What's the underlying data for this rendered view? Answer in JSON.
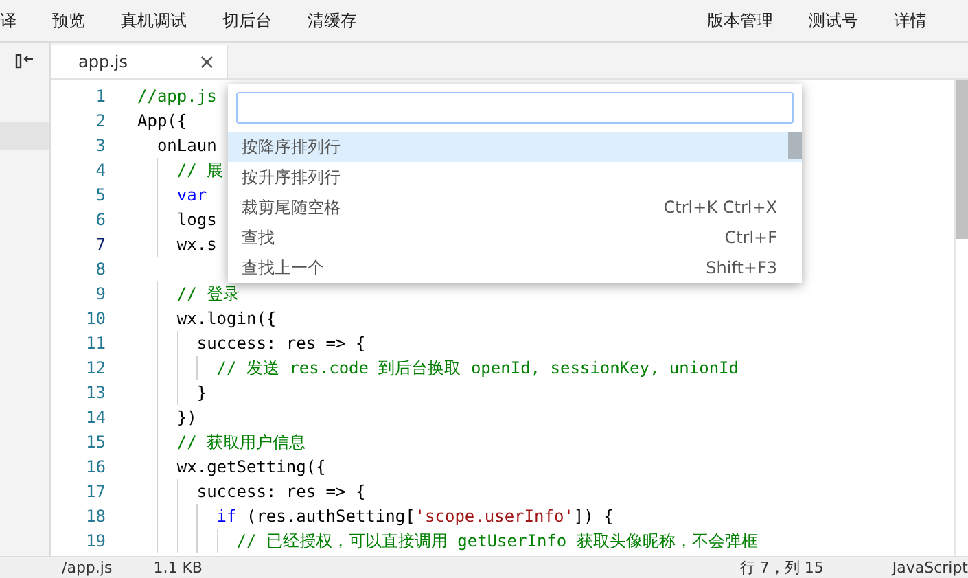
{
  "toolbar": {
    "left": [
      "译",
      "预览",
      "真机调试",
      "切后台",
      "清缓存"
    ],
    "right": [
      "版本管理",
      "测试号",
      "详情"
    ]
  },
  "tabs": [
    {
      "label": "app.js",
      "selected": true,
      "close": "×"
    }
  ],
  "editor": {
    "lines": [
      {
        "number": "1",
        "current": false,
        "tokens": [
          {
            "kind": "comment",
            "text": "//app.js"
          }
        ]
      },
      {
        "number": "2",
        "current": false,
        "tokens": [
          {
            "kind": "plain",
            "text": "App({"
          }
        ]
      },
      {
        "number": "3",
        "current": false,
        "tokens": [
          {
            "kind": "plain",
            "text": "  onLaun"
          }
        ]
      },
      {
        "number": "4",
        "current": false,
        "tokens": [
          {
            "kind": "comment",
            "text": "    // 展"
          }
        ]
      },
      {
        "number": "5",
        "current": false,
        "tokens": [
          {
            "kind": "keyword",
            "text": "    var"
          }
        ]
      },
      {
        "number": "6",
        "current": false,
        "tokens": [
          {
            "kind": "plain",
            "text": "    logs"
          }
        ]
      },
      {
        "number": "7",
        "current": true,
        "tokens": [
          {
            "kind": "plain",
            "text": "    wx.s"
          }
        ]
      },
      {
        "number": "8",
        "current": false
      },
      {
        "number": "9",
        "current": false,
        "tokens": [
          {
            "kind": "comment",
            "text": "    // 登录"
          }
        ]
      },
      {
        "number": "10",
        "current": false,
        "tokens": [
          {
            "kind": "plain",
            "text": "    wx.login({"
          }
        ]
      },
      {
        "number": "11",
        "current": false,
        "tokens": [
          {
            "kind": "plain",
            "text": "      success: res => {"
          }
        ]
      },
      {
        "number": "12",
        "current": false,
        "tokens": [
          {
            "kind": "comment",
            "text": "        // 发送 res.code 到后台换取 openId, sessionKey, unionId"
          }
        ]
      },
      {
        "number": "13",
        "current": false,
        "tokens": [
          {
            "kind": "plain",
            "text": "      }"
          }
        ]
      },
      {
        "number": "14",
        "current": false,
        "tokens": [
          {
            "kind": "plain",
            "text": "    })"
          }
        ]
      },
      {
        "number": "15",
        "current": false,
        "tokens": [
          {
            "kind": "comment",
            "text": "    // 获取用户信息"
          }
        ]
      },
      {
        "number": "16",
        "current": false,
        "tokens": [
          {
            "kind": "plain",
            "text": "    wx.getSetting({"
          }
        ]
      },
      {
        "number": "17",
        "current": false,
        "tokens": [
          {
            "kind": "plain",
            "text": "      success: res => {"
          }
        ]
      },
      {
        "number": "18",
        "current": false,
        "tokens": [
          {
            "kind": "keyword",
            "text": "        if"
          },
          {
            "kind": "plain",
            "text": " (res.authSetting["
          },
          {
            "kind": "string",
            "text": "'scope.userInfo'"
          },
          {
            "kind": "plain",
            "text": "]) {"
          }
        ]
      },
      {
        "number": "19",
        "current": false,
        "tokens": [
          {
            "kind": "comment",
            "text": "          // 已经授权，可以直接调用 getUserInfo 获取头像昵称，不会弹框"
          }
        ]
      }
    ]
  },
  "command_palette": {
    "items": [
      {
        "label": "按降序排列行",
        "selected": true
      },
      {
        "label": "按升序排列行",
        "selected": false
      },
      {
        "label": "裁剪尾随空格",
        "shortcut": "Ctrl+K Ctrl+X",
        "selected": false
      },
      {
        "label": "查找",
        "shortcut": "Ctrl+F",
        "selected": false
      },
      {
        "label": "查找上一个",
        "shortcut": "Shift+F3",
        "selected": false
      }
    ]
  },
  "status_bar": {
    "path": "/app.js",
    "size": "1.1 KB",
    "position": "行 7，列 15",
    "language": "JavaScript"
  }
}
